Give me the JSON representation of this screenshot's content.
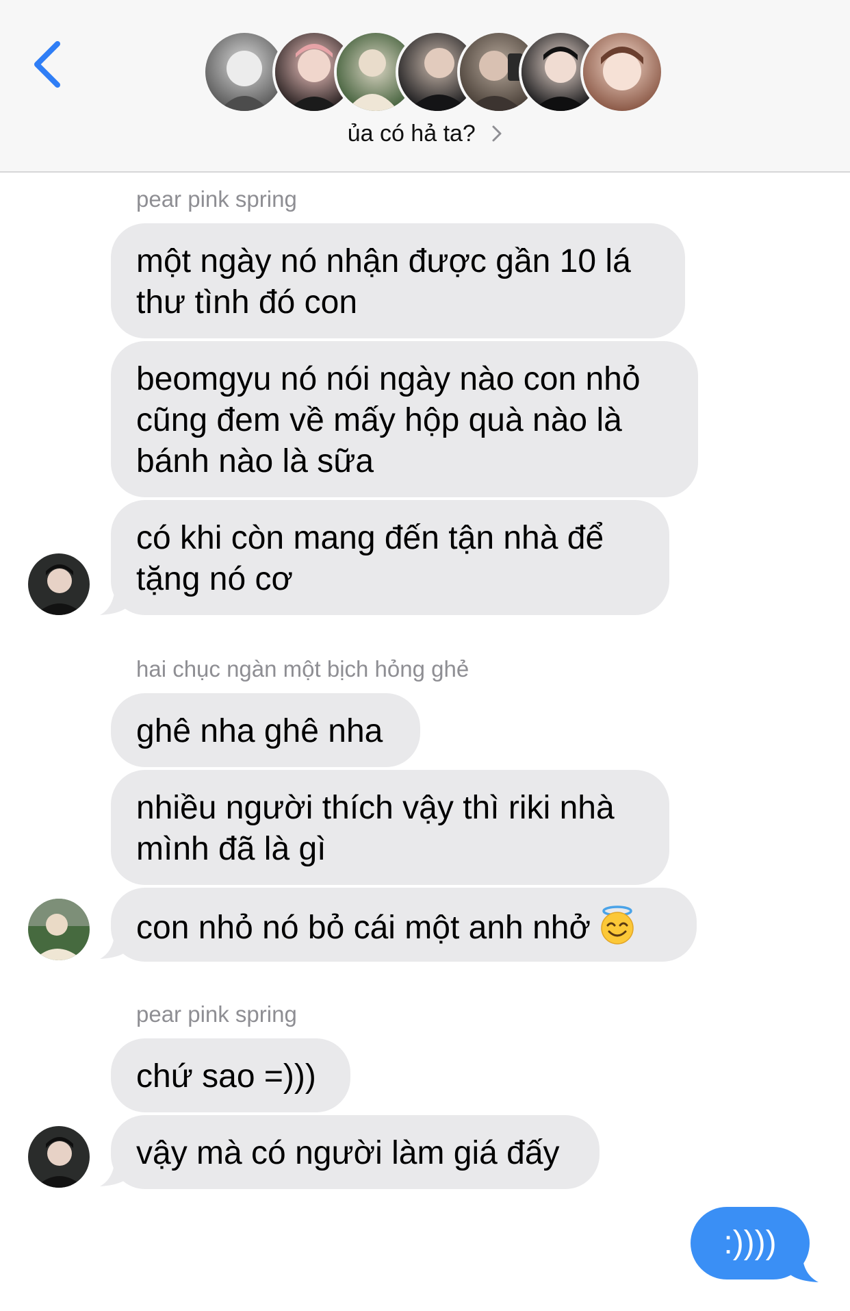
{
  "header": {
    "title": "ủa có hả ta?",
    "back_icon": "chevron-left-icon",
    "avatar_count": 7
  },
  "messages": {
    "group1": {
      "sender": "pear pink spring",
      "bubbles": [
        "một ngày nó nhận được gần 10 lá",
        "thư tình đó con",
        "beomgyu nó nói ngày nào con nhỏ",
        "cũng đem về mấy hộp quà nào là",
        "bánh nào là sữa",
        "có khi còn mang đến tận nhà để",
        "tặng nó cơ"
      ]
    },
    "group2": {
      "sender": "hai chục ngàn một bịch hỏng ghẻ",
      "bubbles": [
        "ghê nha ghê nha",
        "nhiều người thích vậy thì riki nhà",
        "mình đã là gì",
        "con nhỏ nó bỏ cái một anh nhở"
      ],
      "emoji": "smiling-face-with-halo-icon"
    },
    "group3": {
      "sender": "pear pink spring",
      "bubbles": [
        "chứ sao =)))",
        "vậy mà có người làm giá đấy"
      ]
    },
    "outgoing": ":))))"
  },
  "colors": {
    "incoming_bubble": "#e9e9eb",
    "outgoing_bubble": "#3a8ff5",
    "accent": "#2f7ef6",
    "sender_label": "#8e8e93"
  }
}
